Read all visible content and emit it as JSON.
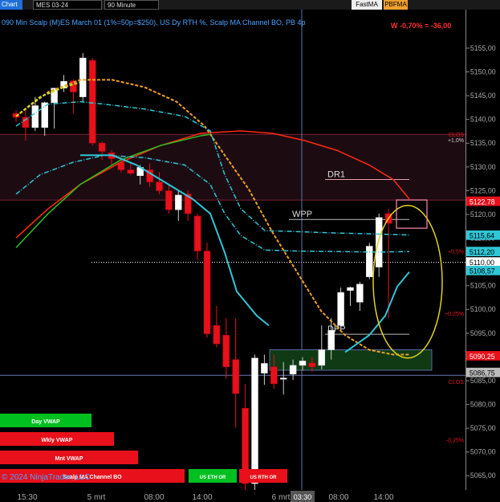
{
  "toolbar": {
    "chart_tab": "Chart",
    "instrument": "MES 03-24",
    "period": "90 Minute",
    "fastma": "FastMA",
    "pbfma": "PBFMA"
  },
  "subtitle": "090 Min Scalp (M)ES March 01 (1%=50p=$250), US Dy RTH %, Scalp MA Channel BO, PB 4p",
  "pnl": "W -0,70% = -36,00",
  "copyright": "© 2024 NinjaTrader, LLC",
  "colors": {
    "up": "#ffffff",
    "down": "#e8101a",
    "upbg": "#00c020",
    "accent": "#1e6fd9"
  },
  "chart_data": {
    "type": "candlestick",
    "y_ticks": [
      "5155,00",
      "5150,00",
      "5145,00",
      "5140,00",
      "5135,00",
      "5130,00",
      "5125,00",
      "5120,00",
      "5115,00",
      "5110,00",
      "5105,00",
      "5100,00",
      "5095,00",
      "5090,00",
      "5085,00",
      "5080,00",
      "5075,00",
      "5070,00",
      "5065,00",
      "5060,00"
    ],
    "ylim": [
      5059,
      5159
    ],
    "x_ticks": [
      "15:30",
      "5 mrt",
      "08:00",
      "14:00",
      "6 mrt",
      "08:00",
      "14:00"
    ],
    "cursor_time": "03:30",
    "price_labels": [
      {
        "text": "5122,78",
        "value": 5122.78,
        "color": "#e8101a",
        "fg": "#fff"
      },
      {
        "text": "5115,64",
        "value": 5115.64,
        "color": "#2fc6d6",
        "fg": "#000"
      },
      {
        "text": "5112,20",
        "value": 5112.2,
        "color": "#2fc6d6",
        "fg": "#000"
      },
      {
        "text": "5110,00",
        "value": 5110.0,
        "color": "#ffffff",
        "fg": "#000"
      },
      {
        "text": "5108,57",
        "value": 5108.2,
        "color": "#2fc6d6",
        "fg": "#000"
      },
      {
        "text": "5090,25",
        "value": 5090.25,
        "color": "#e8101a",
        "fg": "#fff"
      },
      {
        "text": "5086,75",
        "value": 5086.75,
        "color": "#bbbbbb",
        "fg": "#000"
      }
    ],
    "pct_labels": [
      {
        "text": "CLOS",
        "value": 5136.3,
        "color": "#e8101a"
      },
      {
        "text": "+1,0%",
        "value": 5135.2,
        "color": "#ccc"
      },
      {
        "text": "+0,5%",
        "value": 5112.3,
        "color": "#e8101a"
      },
      {
        "text": "+0,25%",
        "value": 5099.5,
        "color": "#e8101a"
      },
      {
        "text": "CLOS",
        "value": 5085.5,
        "color": "#e8101a"
      },
      {
        "text": "-0,25%",
        "value": 5073.5,
        "color": "#e8101a"
      },
      {
        "text": "-0,5%",
        "value": 5060.5,
        "color": "#e8101a"
      }
    ],
    "annotations": [
      {
        "text": "DR1",
        "value": 5127.0
      },
      {
        "text": "WPP",
        "value": 5118.8
      },
      {
        "text": "DPP",
        "value": 5095.2
      }
    ],
    "candles": [
      [
        5140.6,
        5141.2,
        5138.8,
        5139.8
      ],
      [
        5139.8,
        5141.5,
        5135.0,
        5137.7
      ],
      [
        5137.7,
        5144.0,
        5137.0,
        5142.2
      ],
      [
        5137.7,
        5143.0,
        5136.0,
        5142.8
      ],
      [
        5142.8,
        5144.5,
        5137.5,
        5145.8
      ],
      [
        5145.8,
        5148.5,
        5145.0,
        5147.2
      ],
      [
        5147.3,
        5147.6,
        5140.5,
        5145.0
      ],
      [
        5144.0,
        5153.0,
        5143.0,
        5152.0
      ],
      [
        5151.5,
        5152.0,
        5134.0,
        5134.5
      ],
      [
        5134.5,
        5134.8,
        5131.0,
        5132.8
      ],
      [
        5132.5,
        5133.0,
        5130.0,
        5131.3
      ],
      [
        5130.5,
        5132.0,
        5128.5,
        5129.0
      ],
      [
        5129.0,
        5130.5,
        5128.0,
        5128.3
      ],
      [
        5127.8,
        5130.0,
        5126.0,
        5129.5
      ],
      [
        5129.0,
        5130.3,
        5125.5,
        5126.5
      ],
      [
        5126.5,
        5128.5,
        5124.0,
        5124.7
      ],
      [
        5124.7,
        5126.0,
        5120.0,
        5120.8
      ],
      [
        5120.8,
        5124.8,
        5118.5,
        5123.8
      ],
      [
        5124.0,
        5124.8,
        5118.5,
        5120.0
      ],
      [
        5119.5,
        5120.0,
        5110.5,
        5112.3
      ],
      [
        5112.3,
        5114.0,
        5094.5,
        5095.3
      ],
      [
        5097.0,
        5101.0,
        5092.5,
        5093.2
      ],
      [
        5095.0,
        5098.5,
        5086.0,
        5088.5
      ],
      [
        5090.0,
        5098.5,
        5076.0,
        5083.0
      ],
      [
        5080.0,
        5085.0,
        5063.0,
        5064.5
      ],
      [
        5064.5,
        5091.0,
        5062.5,
        5090.3
      ],
      [
        5087.2,
        5091.0,
        5084.8,
        5089.2
      ],
      [
        5088.5,
        5091.0,
        5084.0,
        5085.0
      ],
      [
        5086.0,
        5089.5,
        5082.8,
        5086.2
      ],
      [
        5087.0,
        5090.0,
        5085.8,
        5088.8
      ],
      [
        5088.8,
        5090.5,
        5087.7,
        5089.7
      ],
      [
        5089.3,
        5090.5,
        5087.5,
        5088.5
      ],
      [
        5088.8,
        5097.0,
        5088.0,
        5092.0
      ],
      [
        5092.0,
        5098.5,
        5090.0,
        5096.0
      ],
      [
        5097.0,
        5104.8,
        5096.5,
        5103.8
      ],
      [
        5104.2,
        5105.0,
        5101.0,
        5104.8
      ],
      [
        5101.8,
        5106.0,
        5100.0,
        5105.5
      ],
      [
        5107.0,
        5114.0,
        5106.5,
        5113.3
      ],
      [
        5109.0,
        5120.0,
        5107.0,
        5119.2
      ],
      [
        5120.0,
        5121.0,
        5098.5,
        5118.0
      ]
    ],
    "indicators": [
      {
        "name": "Day VWAP",
        "color": "#00c020",
        "bar": "green"
      },
      {
        "name": "Wkly VWAP",
        "color": "#e8101a"
      },
      {
        "name": "Mnt VWAP",
        "color": "#e8101a"
      },
      {
        "name": "Scalp MA Channel BO",
        "color": "#e8101a"
      },
      {
        "name": "US ETH OR",
        "color": "#00c020"
      },
      {
        "name": "US RTH OR",
        "color": "#e8101a"
      }
    ]
  }
}
